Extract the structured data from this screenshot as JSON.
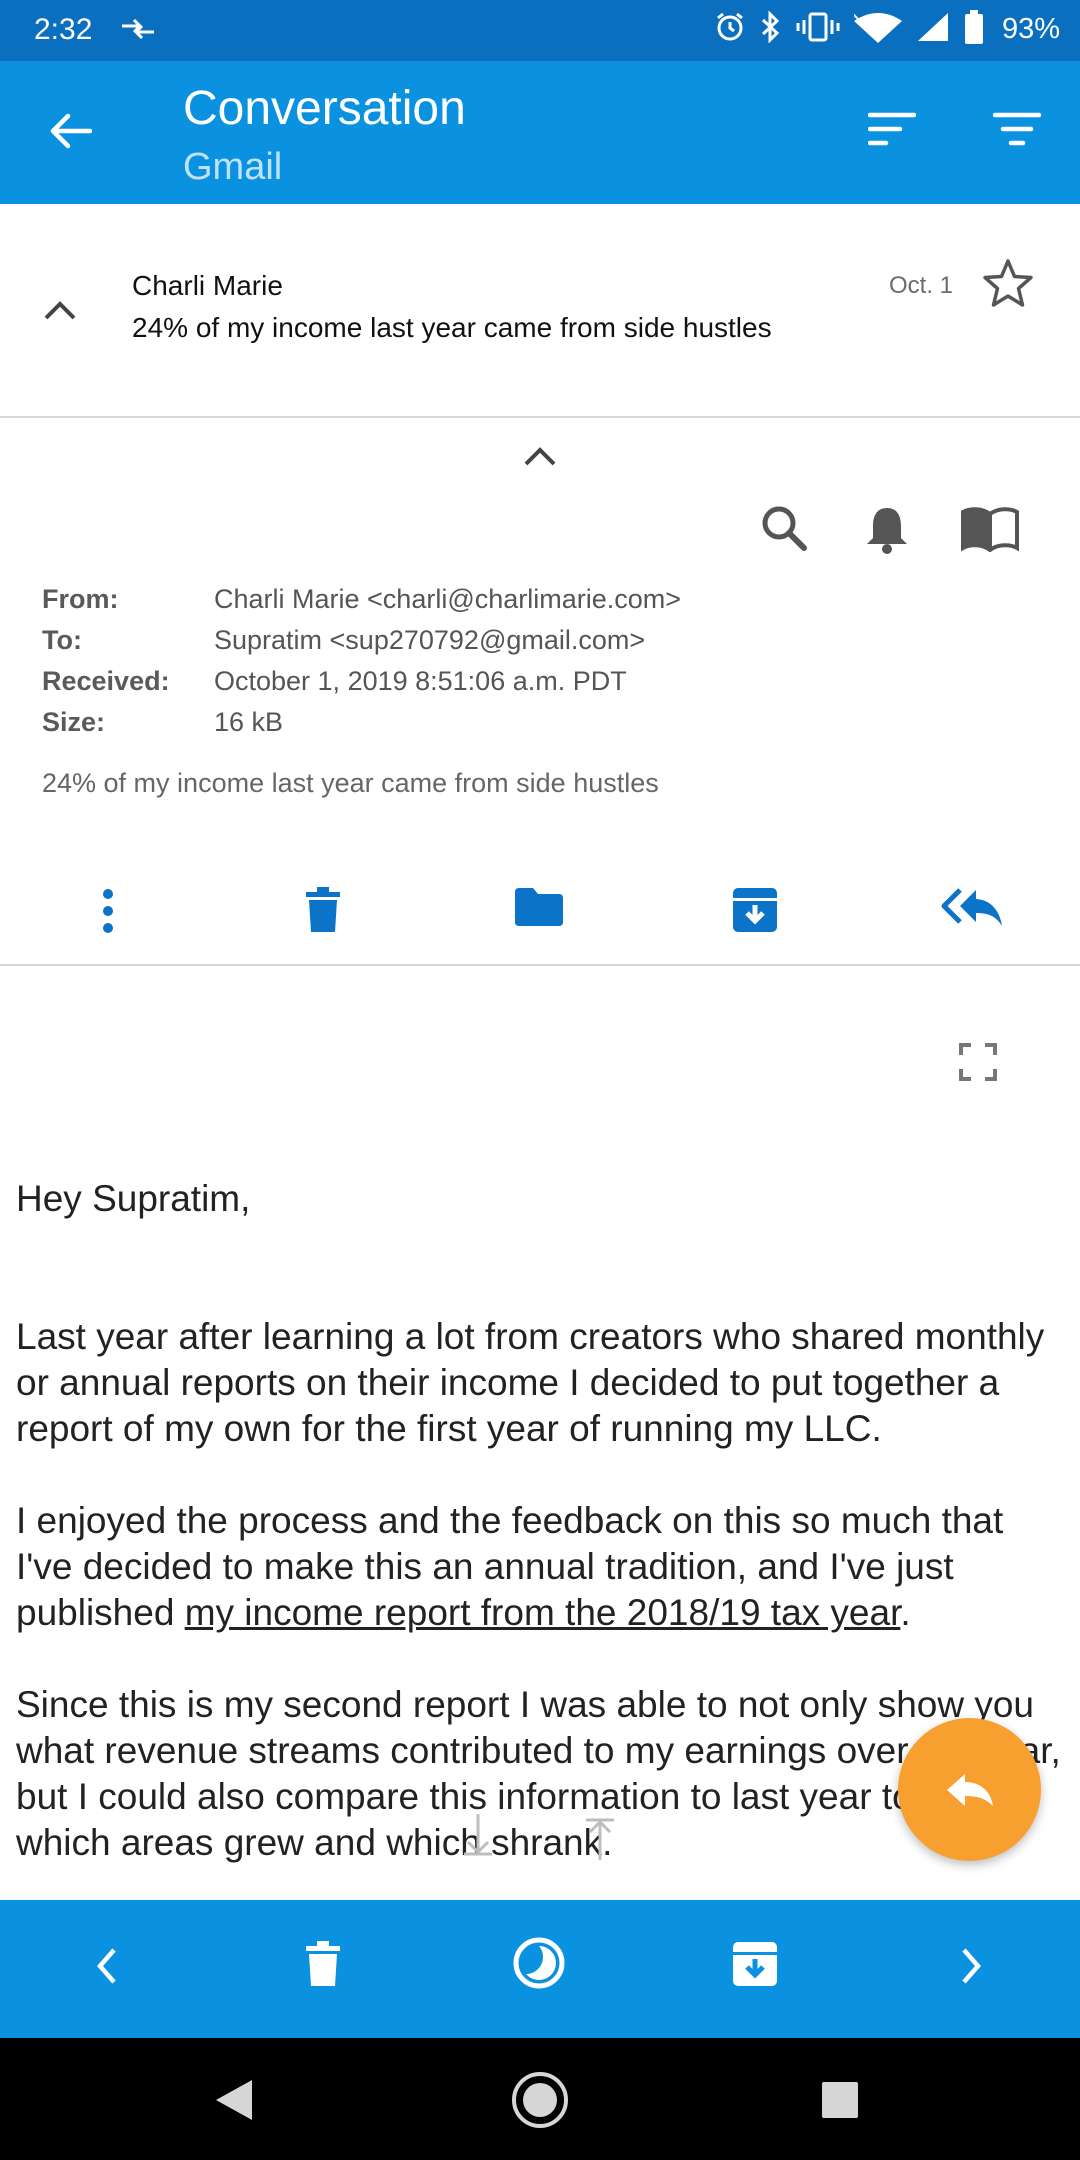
{
  "status_bar": {
    "time": "2:32",
    "battery": "93%"
  },
  "app_bar": {
    "title": "Conversation",
    "subtitle": "Gmail"
  },
  "message": {
    "sender": "Charli Marie",
    "subject": "24% of my income last year came from side hustles",
    "date": "Oct. 1"
  },
  "details": {
    "rows": [
      {
        "label": "From:",
        "value": "Charli Marie <charli@charlimarie.com>"
      },
      {
        "label": "To:",
        "value": "Supratim <sup270792@gmail.com>"
      },
      {
        "label": "Received:",
        "value": "October 1, 2019 8:51:06 a.m. PDT"
      },
      {
        "label": "Size:",
        "value": "16 kB"
      }
    ],
    "snippet": "24% of my income last year came from side hustles"
  },
  "body": {
    "greeting": "Hey Supratim,",
    "p1": "Last year after learning a lot from creators who shared monthly or annual reports on their income I decided to put together a report of my own for the first year of running my LLC.",
    "p2_before": "I enjoyed the process and the feedback on this so much that I've decided to make this an annual tradition, and I've just published ",
    "p2_link": "my income report from the 2018/19 tax year",
    "p2_after": ".",
    "p3": "Since this is my second report I was able to not only show you what revenue streams contributed to my earnings over the year, but I could also compare this information to last year to see which areas grew and which shrank."
  },
  "colors": {
    "app_bar": "#0a92e1",
    "status_bar": "#0b6fbf",
    "accent_icons": "#0b73c8",
    "fab": "#f7a030"
  }
}
